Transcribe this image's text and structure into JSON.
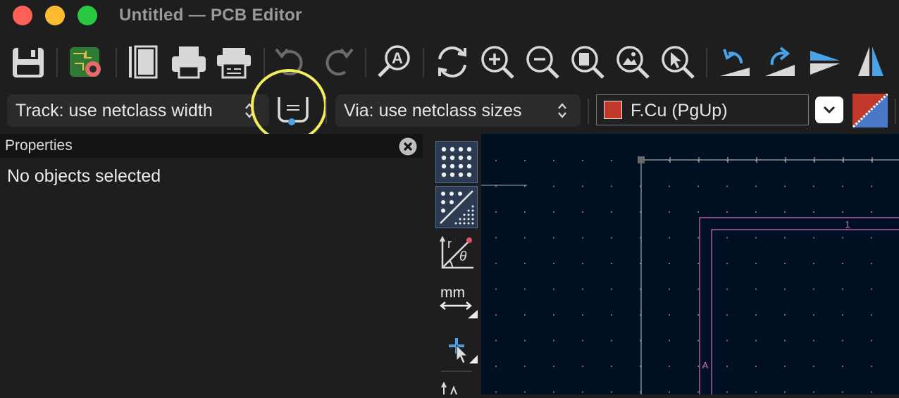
{
  "window": {
    "title": "Untitled — PCB Editor",
    "controls": {
      "close_color": "#ff5f57",
      "minimize_color": "#febc2e",
      "zoom_color": "#28c840"
    }
  },
  "main_toolbar": {
    "icons": [
      "save-icon",
      "board-setup-icon",
      "page-settings-icon",
      "print-icon",
      "plot-icon",
      "undo-icon",
      "redo-icon",
      "find-icon",
      "refresh-icon",
      "zoom-in-icon",
      "zoom-out-icon",
      "zoom-fit-icon",
      "zoom-objects-icon",
      "zoom-selection-icon",
      "rotate-ccw-icon",
      "rotate-cw-icon",
      "flip-vertical-icon",
      "mirror-horizontal-icon"
    ]
  },
  "aux_toolbar": {
    "track_width": "Track: use netclass width",
    "via_size": "Via: use netclass sizes",
    "layer": "F.Cu (PgUp)",
    "layer_color": "#c0392b",
    "highlighted_icon": "auto-track-width-icon",
    "highlight_color": "#f2ef5a"
  },
  "properties_panel": {
    "title": "Properties",
    "empty_message": "No objects selected"
  },
  "left_toolbar": {
    "items": [
      "grid-dots-icon",
      "grid-overrides-icon",
      "polar-coordinates-icon",
      "units-mm-icon",
      "cursor-crosshair-icon",
      "measure-icon"
    ],
    "units_label": "mm",
    "polar_r": "r",
    "polar_theta": "θ"
  },
  "canvas": {
    "background": "#001023",
    "drawing_sheet": {
      "column_label": "1",
      "row_label": "A",
      "color": "#d86fb8"
    }
  }
}
